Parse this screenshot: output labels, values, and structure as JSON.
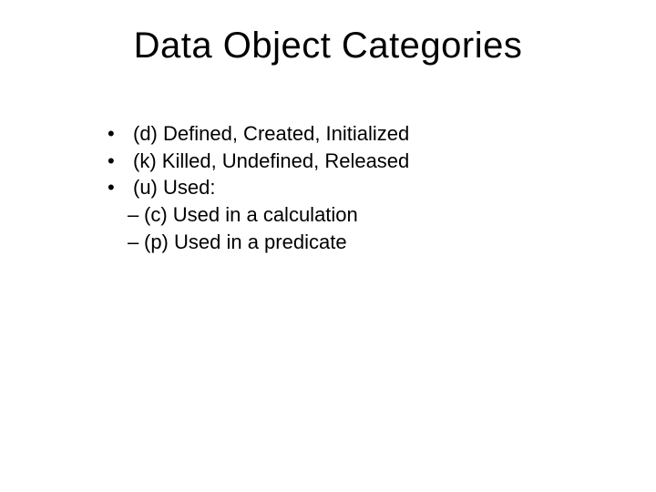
{
  "title": "Data Object Categories",
  "bullets": {
    "b0": "(d) Defined, Created, Initialized",
    "b1": "(k) Killed, Undefined, Released",
    "b2": "(u) Used:",
    "sub0": "(c) Used in a calculation",
    "sub1": "(p) Used in a predicate"
  },
  "marks": {
    "bullet": "•",
    "dash": "–"
  }
}
